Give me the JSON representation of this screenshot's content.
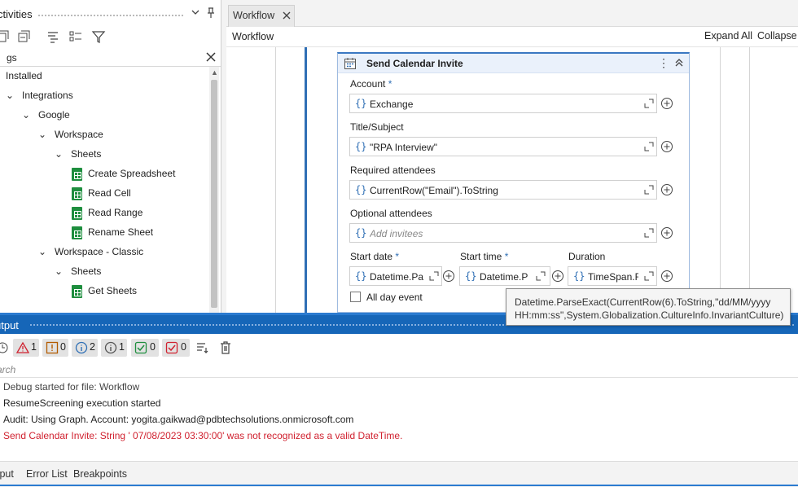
{
  "activities": {
    "title": "ctivities",
    "search_value": "gs",
    "tree": [
      {
        "label": "Installed",
        "level": 0,
        "kind": "folder"
      },
      {
        "label": "Integrations",
        "level": 1,
        "kind": "folder"
      },
      {
        "label": "Google",
        "level": 2,
        "kind": "folder"
      },
      {
        "label": "Workspace",
        "level": 3,
        "kind": "folder"
      },
      {
        "label": "Sheets",
        "level": 4,
        "kind": "folder"
      },
      {
        "label": "Create Spreadsheet",
        "level": 5,
        "kind": "sheet"
      },
      {
        "label": "Read Cell",
        "level": 5,
        "kind": "sheet"
      },
      {
        "label": "Read Range",
        "level": 5,
        "kind": "sheet"
      },
      {
        "label": "Rename Sheet",
        "level": 5,
        "kind": "sheet"
      },
      {
        "label": "Workspace - Classic",
        "level": 3,
        "kind": "folder"
      },
      {
        "label": "Sheets",
        "level": 4,
        "kind": "folder"
      },
      {
        "label": "Get Sheets",
        "level": 5,
        "kind": "sheet"
      }
    ]
  },
  "workflow": {
    "tab_label": "Workflow",
    "breadcrumb": "Workflow",
    "expand_all": "Expand All",
    "collapse_all": "Collapse A"
  },
  "card": {
    "title": "Send Calendar Invite",
    "account_label": "Account",
    "account_value": "Exchange",
    "title_label": "Title/Subject",
    "title_value": "\"RPA Interview\"",
    "required_label": "Required attendees",
    "required_value": "CurrentRow(\"Email\").ToString",
    "optional_label": "Optional attendees",
    "optional_placeholder": "Add invitees",
    "start_date_label": "Start date",
    "start_date_value": "Datetime.Pa",
    "start_time_label": "Start time",
    "start_time_value": "Datetime.P",
    "duration_label": "Duration",
    "duration_value": "TimeSpan.F",
    "all_day_label": "All day event",
    "required_marker": "*"
  },
  "tooltip": {
    "line1": "Datetime.ParseExact(CurrentRow(6).ToString,\"dd/MM/yyyy",
    "line2": "HH:mm:ss\",System.Globalization.CultureInfo.InvariantCulture)"
  },
  "output": {
    "title": "utput",
    "counts": {
      "errors": "1",
      "warnings": "0",
      "info": "2",
      "trace": "1",
      "success": "0",
      "failed": "0"
    },
    "search_placeholder": "arch",
    "logs": [
      {
        "text": "Debug started for file: Workflow",
        "level": "debug"
      },
      {
        "text": "ResumeScreening execution started",
        "level": "info"
      },
      {
        "text": "Audit: Using Graph. Account: yogita.gaikwad@pdbtechsolutions.onmicrosoft.com",
        "level": "info"
      },
      {
        "text": "Send Calendar Invite: String ' 07/08/2023 03:30:00' was not recognized as a valid DateTime.",
        "level": "error"
      }
    ],
    "tabs": [
      "tput",
      "Error List",
      "Breakpoints"
    ]
  },
  "colors": {
    "accent": "#1666b8",
    "error": "#d0212f",
    "sheets_green": "#1e8e3e"
  }
}
